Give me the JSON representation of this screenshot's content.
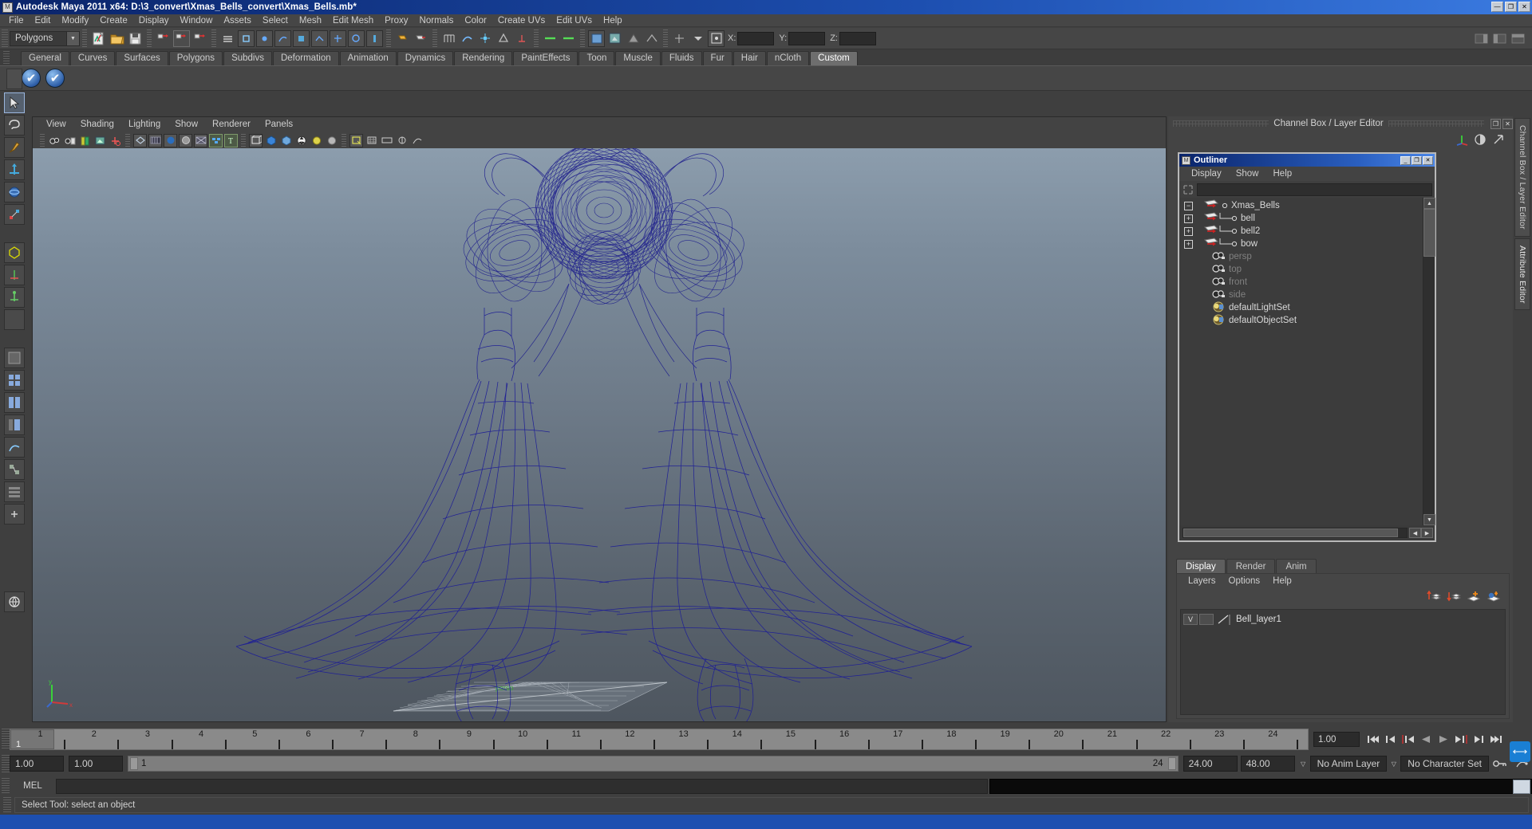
{
  "window": {
    "title": "Autodesk Maya 2011 x64: D:\\3_convert\\Xmas_Bells_convert\\Xmas_Bells.mb*",
    "icon": "maya-app-icon",
    "minimize": "—",
    "maximize": "❐",
    "close": "✕"
  },
  "menubar": {
    "items": [
      "File",
      "Edit",
      "Modify",
      "Create",
      "Display",
      "Window",
      "Assets",
      "Select",
      "Mesh",
      "Edit Mesh",
      "Proxy",
      "Normals",
      "Color",
      "Create UVs",
      "Edit UVs",
      "Help"
    ]
  },
  "statusline": {
    "menu_set": "Polygons",
    "coord_labels": {
      "x": "X:",
      "y": "Y:",
      "z": "Z:"
    },
    "coord_values": {
      "x": "",
      "y": "",
      "z": ""
    }
  },
  "shelf": {
    "tabs": [
      "General",
      "Curves",
      "Surfaces",
      "Polygons",
      "Subdivs",
      "Deformation",
      "Animation",
      "Dynamics",
      "Rendering",
      "PaintEffects",
      "Toon",
      "Muscle",
      "Fluids",
      "Fur",
      "Hair",
      "nCloth",
      "Custom"
    ],
    "active_tab": "Custom"
  },
  "viewport": {
    "menus": [
      "View",
      "Shading",
      "Lighting",
      "Show",
      "Renderer",
      "Panels"
    ],
    "axis": {
      "x": "x",
      "y": "y",
      "z": "z"
    },
    "scene_description": "Wireframe view of two Christmas bells with a bow, blue wireframe on blue-grey gradient background"
  },
  "channel_box_dock": {
    "title": "Channel Box / Layer Editor",
    "undock": "❐",
    "close": "✕"
  },
  "outliner": {
    "title": "Outliner",
    "minimize": "_",
    "maximize": "❒",
    "close": "✕",
    "menus": [
      "Display",
      "Show",
      "Help"
    ],
    "search_value": "",
    "items": [
      {
        "label": "Xmas_Bells",
        "expander": "−",
        "icon": "transform-icon",
        "indent": 0,
        "dim": false
      },
      {
        "label": "bell",
        "expander": "+",
        "icon": "transform-icon",
        "indent": 1,
        "dim": false
      },
      {
        "label": "bell2",
        "expander": "+",
        "icon": "transform-icon",
        "indent": 1,
        "dim": false
      },
      {
        "label": "bow",
        "expander": "+",
        "icon": "transform-icon",
        "indent": 1,
        "dim": false
      },
      {
        "label": "persp",
        "expander": "",
        "icon": "camera-icon",
        "indent": 0,
        "dim": true
      },
      {
        "label": "top",
        "expander": "",
        "icon": "camera-icon",
        "indent": 0,
        "dim": true
      },
      {
        "label": "front",
        "expander": "",
        "icon": "camera-icon",
        "indent": 0,
        "dim": true
      },
      {
        "label": "side",
        "expander": "",
        "icon": "camera-icon",
        "indent": 0,
        "dim": true
      },
      {
        "label": "defaultLightSet",
        "expander": "",
        "icon": "set-icon",
        "indent": 0,
        "dim": false
      },
      {
        "label": "defaultObjectSet",
        "expander": "",
        "icon": "set-icon",
        "indent": 0,
        "dim": false
      }
    ]
  },
  "layer_editor": {
    "tabs": [
      "Display",
      "Render",
      "Anim"
    ],
    "active_tab": "Display",
    "menus": [
      "Layers",
      "Options",
      "Help"
    ],
    "layers": [
      {
        "visibility": "V",
        "playback": "",
        "name": "Bell_layer1"
      }
    ]
  },
  "right_tabs": {
    "items": [
      "Channel Box / Layer Editor",
      "Attribute Editor"
    ],
    "active": "Attribute Editor"
  },
  "time_slider": {
    "ticks": [
      "1",
      "2",
      "3",
      "4",
      "5",
      "6",
      "7",
      "8",
      "9",
      "10",
      "11",
      "12",
      "13",
      "14",
      "15",
      "16",
      "17",
      "18",
      "19",
      "20",
      "21",
      "22",
      "23",
      "24"
    ],
    "current_frame_label": "1",
    "current_time_field": "1.00",
    "playback_buttons": [
      "go-to-start",
      "step-back-key",
      "step-back-frame",
      "play-backwards",
      "play-forwards",
      "step-forward-frame",
      "step-forward-key",
      "go-to-end"
    ]
  },
  "range_slider": {
    "start_field": "1.00",
    "end_field": "1.00",
    "range_start_label": "1",
    "range_end_label": "24",
    "playback_start": "24.00",
    "playback_end": "48.00",
    "anim_layer": "No Anim Layer",
    "character_set": "No Character Set"
  },
  "command_line": {
    "label": "MEL",
    "input_value": "",
    "output_value": ""
  },
  "help_line": {
    "text": "Select Tool: select an object"
  },
  "colors": {
    "title_blue": "#1d4fb0",
    "wireframe_blue": "#1c1c8c",
    "panel_grey": "#444444",
    "active_tab": "#6e6e6e"
  }
}
